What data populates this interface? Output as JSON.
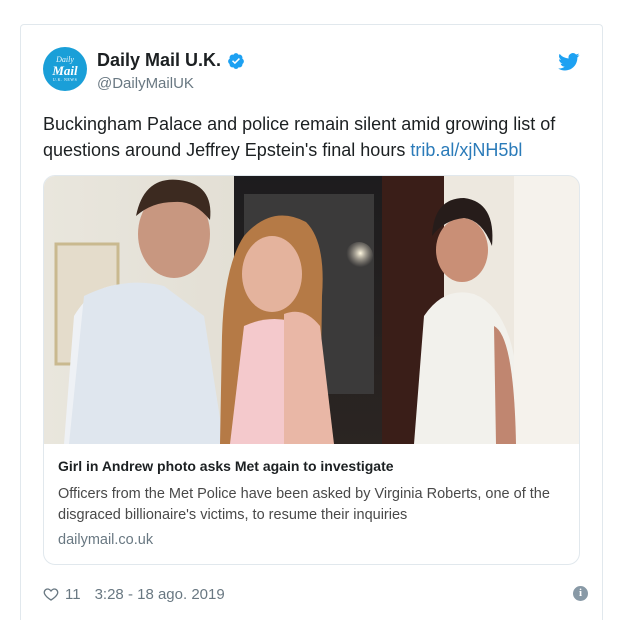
{
  "account": {
    "avatar_line1": "Daily",
    "avatar_line2": "Mail",
    "avatar_line3": "U.K. NEWS",
    "display_name": "Daily Mail U.K.",
    "handle": "@DailyMailUK"
  },
  "tweet": {
    "text": "Buckingham Palace and police remain silent amid growing list of questions around Jeffrey Epstein's final hours",
    "link": "trib.al/xjNH5bl"
  },
  "card": {
    "title": "Girl in Andrew photo asks Met again to investigate",
    "description": "Officers from the Met Police have been asked by Virginia Roberts, one of the disgraced billionaire's victims, to resume their inquiries",
    "domain": "dailymail.co.uk"
  },
  "footer": {
    "likes": "11",
    "timestamp": "3:28 - 18 ago. 2019"
  },
  "colors": {
    "link": "#2b7bb9",
    "twitter_blue": "#1da1f2",
    "avatar": "#1a9fd8"
  }
}
